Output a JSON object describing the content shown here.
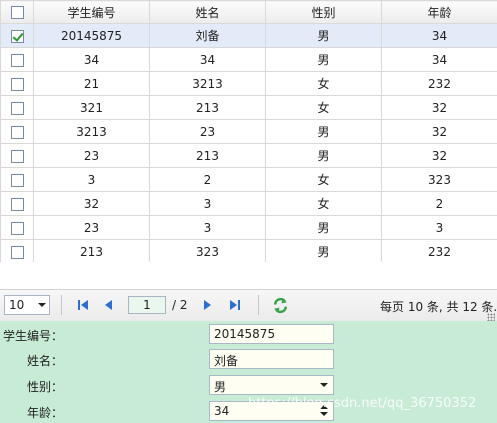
{
  "grid": {
    "columns": [
      "学生编号",
      "姓名",
      "性别",
      "年龄"
    ],
    "rows": [
      {
        "id": "20145875",
        "name": "刘备",
        "gender": "男",
        "age": "34",
        "checked": true
      },
      {
        "id": "34",
        "name": "34",
        "gender": "男",
        "age": "34",
        "checked": false
      },
      {
        "id": "21",
        "name": "3213",
        "gender": "女",
        "age": "232",
        "checked": false
      },
      {
        "id": "321",
        "name": "213",
        "gender": "女",
        "age": "32",
        "checked": false
      },
      {
        "id": "3213",
        "name": "23",
        "gender": "男",
        "age": "32",
        "checked": false
      },
      {
        "id": "23",
        "name": "213",
        "gender": "男",
        "age": "32",
        "checked": false
      },
      {
        "id": "3",
        "name": "2",
        "gender": "女",
        "age": "323",
        "checked": false
      },
      {
        "id": "32",
        "name": "3",
        "gender": "女",
        "age": "2",
        "checked": false
      },
      {
        "id": "23",
        "name": "3",
        "gender": "男",
        "age": "3",
        "checked": false
      },
      {
        "id": "213",
        "name": "323",
        "gender": "男",
        "age": "232",
        "checked": false
      }
    ]
  },
  "pager": {
    "page_size": "10",
    "current_page": "1",
    "total_pages": "/ 2",
    "summary": "每页 10 条, 共 12 条."
  },
  "form": {
    "id_label": "学生编号：",
    "id_value": "20145875",
    "name_label": "姓名：",
    "name_value": "刘备",
    "gender_label": "性别：",
    "gender_value": "男",
    "age_label": "年龄：",
    "age_value": "34"
  },
  "watermark": "https://blog.csdn.net/qq_36750352",
  "colors": {
    "selected_row": "#e3ebf8",
    "form_background": "#c7ebd4",
    "nav_arrow": "#2c6fd1",
    "refresh": "#3aa34a"
  }
}
